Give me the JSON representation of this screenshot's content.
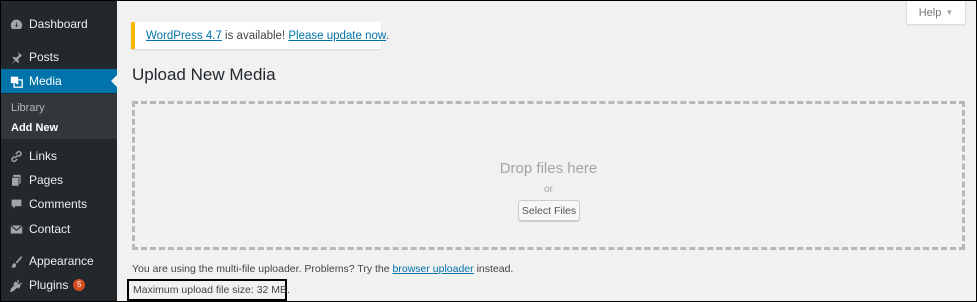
{
  "sidebar": {
    "items": [
      {
        "label": "Dashboard",
        "icon": "dashboard-icon"
      },
      {
        "label": "Posts",
        "icon": "pin-icon"
      },
      {
        "label": "Media",
        "icon": "media-icon",
        "current": true
      },
      {
        "label": "Links",
        "icon": "link-icon"
      },
      {
        "label": "Pages",
        "icon": "page-icon"
      },
      {
        "label": "Comments",
        "icon": "comment-icon"
      },
      {
        "label": "Contact",
        "icon": "mail-icon"
      },
      {
        "label": "Appearance",
        "icon": "brush-icon"
      },
      {
        "label": "Plugins",
        "icon": "plug-icon",
        "badge": "5"
      }
    ],
    "submenu": [
      {
        "label": "Library"
      },
      {
        "label": "Add New",
        "active": true
      }
    ]
  },
  "help_tab": {
    "label": "Help"
  },
  "notice": {
    "version_link": "WordPress 4.7",
    "middle_text": " is available! ",
    "update_link": "Please update now",
    "end_text": "."
  },
  "page_title": "Upload New Media",
  "dropzone": {
    "drop_text": "Drop files here",
    "or_text": "or",
    "select_button": "Select Files"
  },
  "uploader_note": {
    "before": "You are using the multi-file uploader. Problems? Try the ",
    "link": "browser uploader",
    "after": " instead."
  },
  "max_upload": "Maximum upload file size: 32 MB.",
  "colors": {
    "sidebar_bg": "#23282d",
    "accent": "#0073aa",
    "notice_border": "#ffb900",
    "badge": "#d54e21"
  }
}
